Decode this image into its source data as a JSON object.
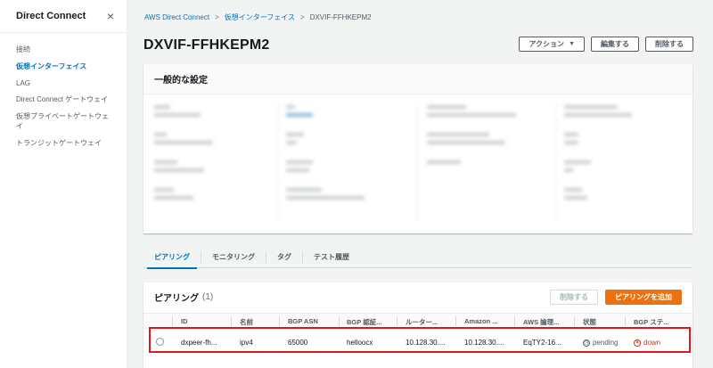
{
  "sidebar": {
    "title": "Direct Connect",
    "close_icon": "×",
    "items": [
      {
        "label": "接続"
      },
      {
        "label": "仮想インターフェイス"
      },
      {
        "label": "LAG"
      },
      {
        "label": "Direct Connect ゲートウェイ"
      },
      {
        "label": "仮想プライベートゲートウェ\nイ"
      },
      {
        "label": "トランジットゲートウェイ"
      }
    ]
  },
  "breadcrumb": {
    "items": [
      "AWS Direct Connect",
      "仮想インターフェイス",
      "DXVIF-FFHKEPM2"
    ],
    "separator": ">"
  },
  "page": {
    "title": "DXVIF-FFHKEPM2",
    "actions_label": "アクション",
    "edit_label": "編集する",
    "delete_label": "削除する"
  },
  "general": {
    "heading": "一般的な設定"
  },
  "tabs": [
    "ピアリング",
    "モニタリング",
    "タグ",
    "テスト履歴"
  ],
  "peering": {
    "title": "ピアリング",
    "count": "(1)",
    "delete_label": "削除する",
    "add_label": "ピアリングを追加",
    "columns": [
      "ID",
      "名前",
      "BGP ASN",
      "BGP 認証...",
      "ルーター...",
      "Amazon ...",
      "AWS 論理...",
      "状態",
      "BGP ステ..."
    ],
    "rows": [
      {
        "id": "dxpeer-fh...",
        "name": "ipv4",
        "asn": "65000",
        "auth": "hellooсx",
        "router": "10.128.30....",
        "amazon": "10.128.30....",
        "logical": "EqTY2-16...",
        "state": "pending",
        "bgp_status": "down"
      }
    ]
  },
  "colors": {
    "accent": "#0073bb",
    "primary_button": "#ec7211",
    "error": "#d13212",
    "highlight": "#e3141a"
  }
}
